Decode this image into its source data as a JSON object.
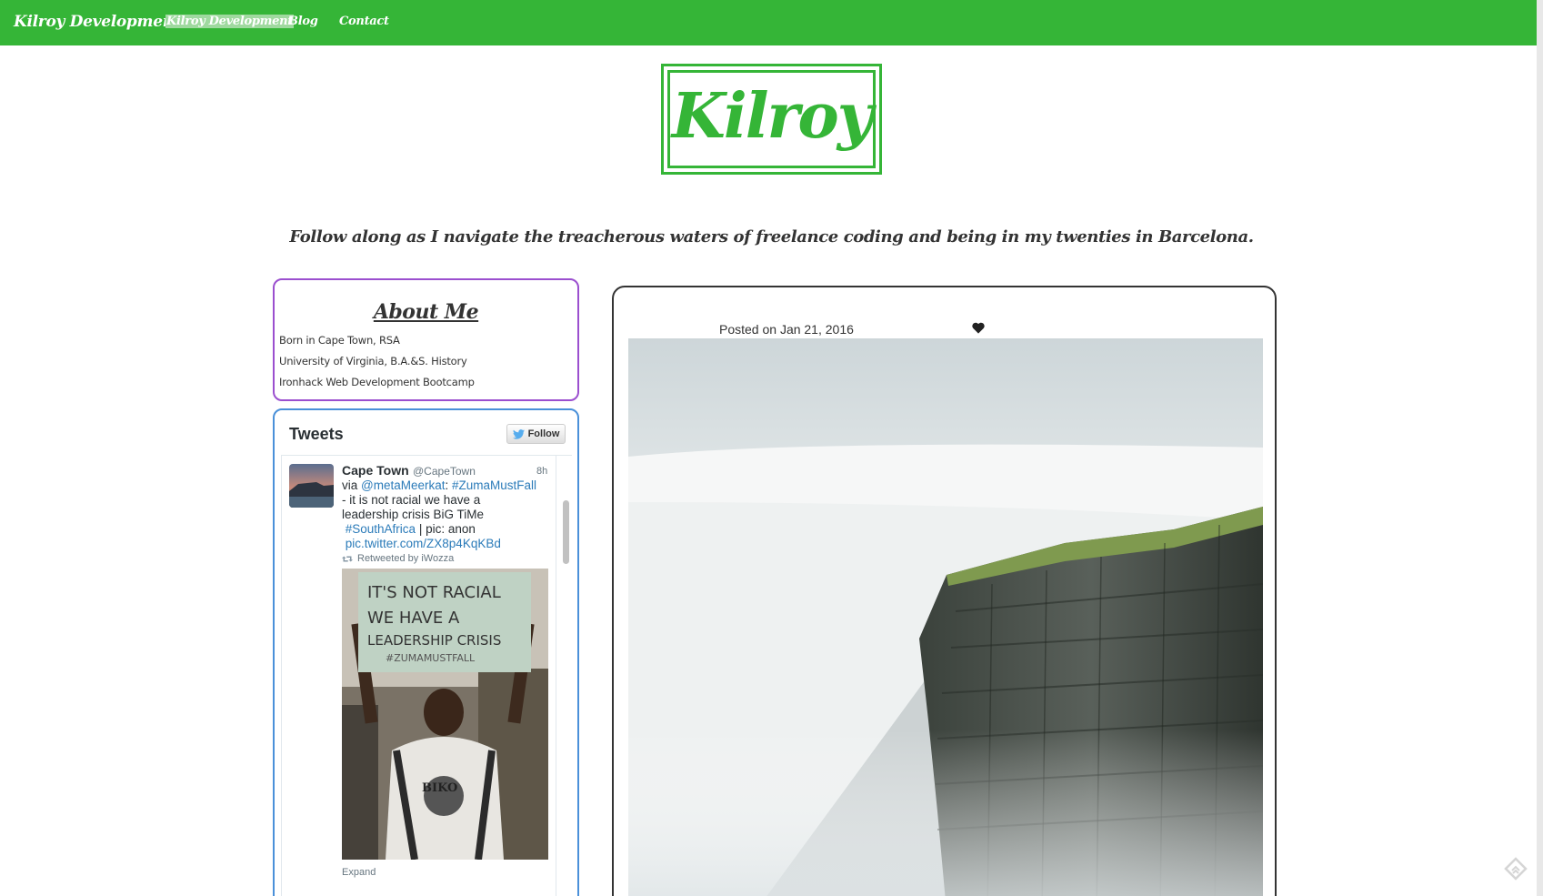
{
  "navbar": {
    "brand": "Kilroy Development",
    "links": [
      {
        "label": "Kilroy Development",
        "active": true
      },
      {
        "label": "Blog",
        "active": false
      },
      {
        "label": "Contact",
        "active": false
      }
    ],
    "background": "#35b537"
  },
  "logo": {
    "text": "Kilroy",
    "color": "#35b537"
  },
  "tagline": "Follow along as I navigate the treacherous waters of freelance coding and being in my twenties in Barcelona.",
  "about": {
    "title": "About Me",
    "lines": [
      "Born in Cape Town, RSA",
      "University of Virginia, B.A.&S. History",
      "Ironhack Web Development Bootcamp"
    ],
    "border_color": "#9b4fcf"
  },
  "tweets": {
    "header": "Tweets",
    "follow_label": "Follow",
    "tweet": {
      "name": "Cape Town",
      "handle": "@CapeTown",
      "time": "8h",
      "text_via": "via ",
      "mention": "@metaMeerkat",
      "hashtag1": "#ZumaMustFall",
      "line2": "- it is not racial we have a",
      "line3": "leadership crisis BiG TiMe",
      "hashtag2": "#SouthAfrica",
      "line4_rest": " | pic: anon",
      "pic_link": "pic.twitter.com/ZX8p4KqKBd",
      "retweeted_by": "Retweeted by iWozza",
      "photo_sign": [
        "IT'S NOT RACIAL",
        "WE HAVE A",
        "LEADERSHIP CRISIS",
        "#ZUMAMUSTFALL"
      ],
      "photo_shirt": "BIKO",
      "expand": "Expand"
    },
    "border_color": "#4a90d9"
  },
  "post": {
    "posted_on": "Posted on Jan 21, 2016",
    "heart_icon": "heart-icon",
    "image_subject": "cliff-above-clouds"
  }
}
